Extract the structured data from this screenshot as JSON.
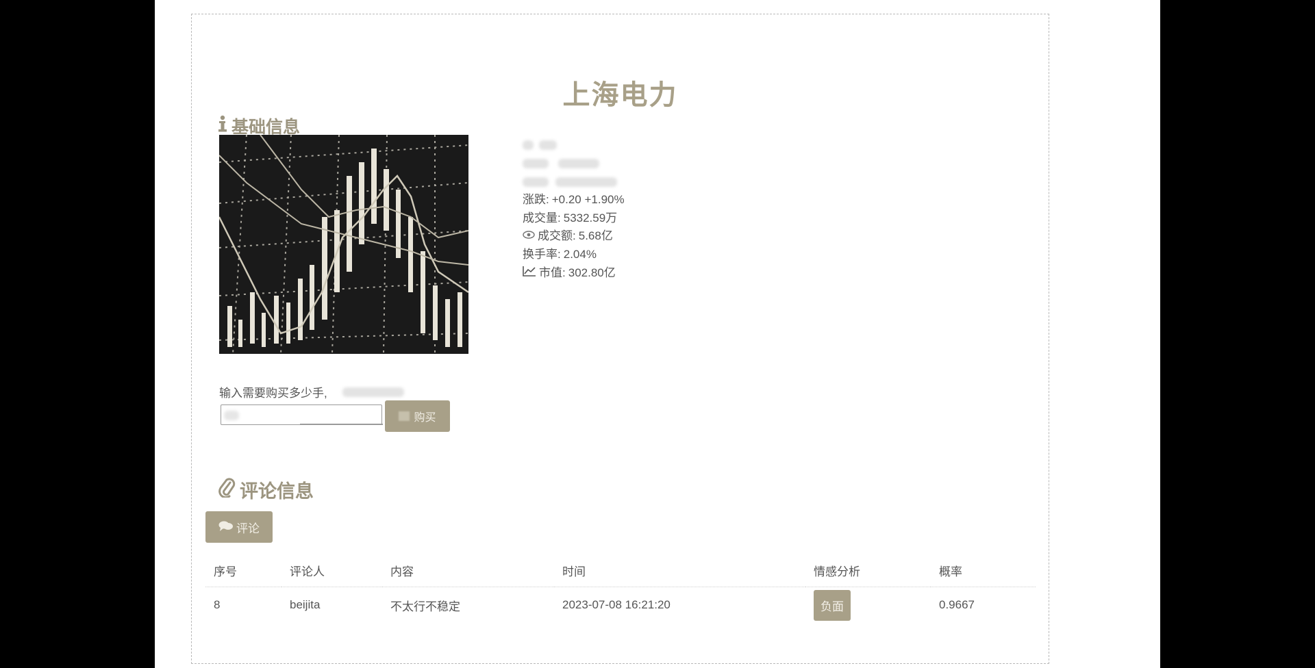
{
  "stock": {
    "name": "上海电力"
  },
  "sections": {
    "basic": "基础信息",
    "comments": "评论信息"
  },
  "info": {
    "change_label": "涨跌:",
    "change_value": "+0.20 +1.90%",
    "volume_label": "成交量:",
    "volume_value": "5332.59万",
    "amount_label": "成交额:",
    "amount_value": "5.68亿",
    "turnover_label": "换手率:",
    "turnover_value": "2.04%",
    "market_cap_label": "市值:",
    "market_cap_value": "302.80亿"
  },
  "buy": {
    "prompt": "输入需要购买多少手,",
    "button_label": "购买"
  },
  "comments": {
    "button_label": "评论",
    "headers": [
      "序号",
      "评论人",
      "内容",
      "时间",
      "情感分析",
      "概率"
    ],
    "rows": [
      {
        "id": "8",
        "author": "beijita",
        "content": "不太行不稳定",
        "time": "2023-07-08 16:21:20",
        "sentiment": "负面",
        "probability": "0.9667"
      }
    ]
  },
  "colors": {
    "accent": "#a8a088",
    "background": "#ffffff",
    "frame": "#000000"
  }
}
